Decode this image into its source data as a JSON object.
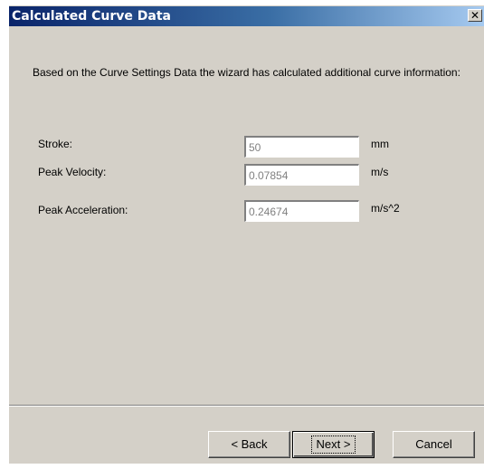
{
  "window": {
    "title": "Calculated Curve Data",
    "close_glyph": "✕"
  },
  "description": "Based on the Curve Settings Data the wizard has calculated additional curve information:",
  "fields": [
    {
      "label": "Stroke:",
      "value": "50",
      "unit": "mm"
    },
    {
      "label": "Peak Velocity:",
      "value": "0.07854",
      "unit": "m/s"
    },
    {
      "label": "Peak Acceleration:",
      "value": "0.24674",
      "unit": "m/s^2"
    }
  ],
  "buttons": {
    "back": "< Back",
    "next": "Next >",
    "cancel": "Cancel"
  },
  "colors": {
    "dialog_bg": "#d4d0c8",
    "titlebar_start": "#0a246a",
    "titlebar_end": "#a6caf0",
    "disabled_text": "#808080"
  }
}
